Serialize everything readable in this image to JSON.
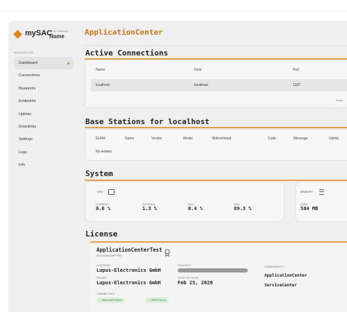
{
  "brand": {
    "name": "mySAC",
    "sub_label": "Minty Gateway",
    "sub_value": "Name"
  },
  "navigation": {
    "heading": "NAVIGATION",
    "items": [
      "Dashboard",
      "Connections",
      "Blueprints",
      "Endpoints",
      "Uplinks",
      "Downlinks",
      "Settings",
      "Logs",
      "Info"
    ]
  },
  "page_title": "ApplicationCenter",
  "active_connections": {
    "title": "Active Connections",
    "columns": [
      "Name",
      "Host",
      "Port"
    ],
    "rows": [
      [
        "localhost",
        "localhost",
        "1337"
      ]
    ],
    "footer": "Items"
  },
  "base_stations": {
    "title": "Base Stations for localhost",
    "columns": [
      "EUI64",
      "Name",
      "Vendor",
      "Model",
      "Bidirectional",
      "Code",
      "Message",
      "Uplink"
    ],
    "empty": "No entries."
  },
  "system": {
    "title": "System",
    "cpu": {
      "label": "CPU",
      "current_label": "CURRENT",
      "current": "0.6 %",
      "average_label": "AVERAGE",
      "average": "1.3 %",
      "min_label": "MIN.",
      "min": "0.4 %",
      "max_label": "MAX.",
      "max": "89.3 %"
    },
    "memory": {
      "label": "MEMORY",
      "used_label": "USED",
      "used": "584 MB"
    }
  },
  "license": {
    "title": "License",
    "product": "ApplicationCenterTest",
    "id": "0DE1E8AD40FF550",
    "licensee_label": "LICENSEE",
    "licensee": "Lupus-Electronics GmbH",
    "contact_label": "CONTACT",
    "issuer_label": "ISSUER",
    "issuer": "Lupus-Electronics GmbH",
    "date_label": "DATE OF ISSUE",
    "date": "Feb 25, 2026",
    "capabilities_label": "CAPABILITIES",
    "capabilities": [
      "Blueprint Parser",
      "UMS Parser"
    ],
    "components_label": "COMPONENTS",
    "components": [
      "ApplicationCenter",
      "ServiceCenter"
    ]
  },
  "colors": {
    "accent": "#e0841c",
    "title": "#c9761a",
    "pill_bg": "#dbeedb",
    "pill_text": "#3a7a3a"
  }
}
